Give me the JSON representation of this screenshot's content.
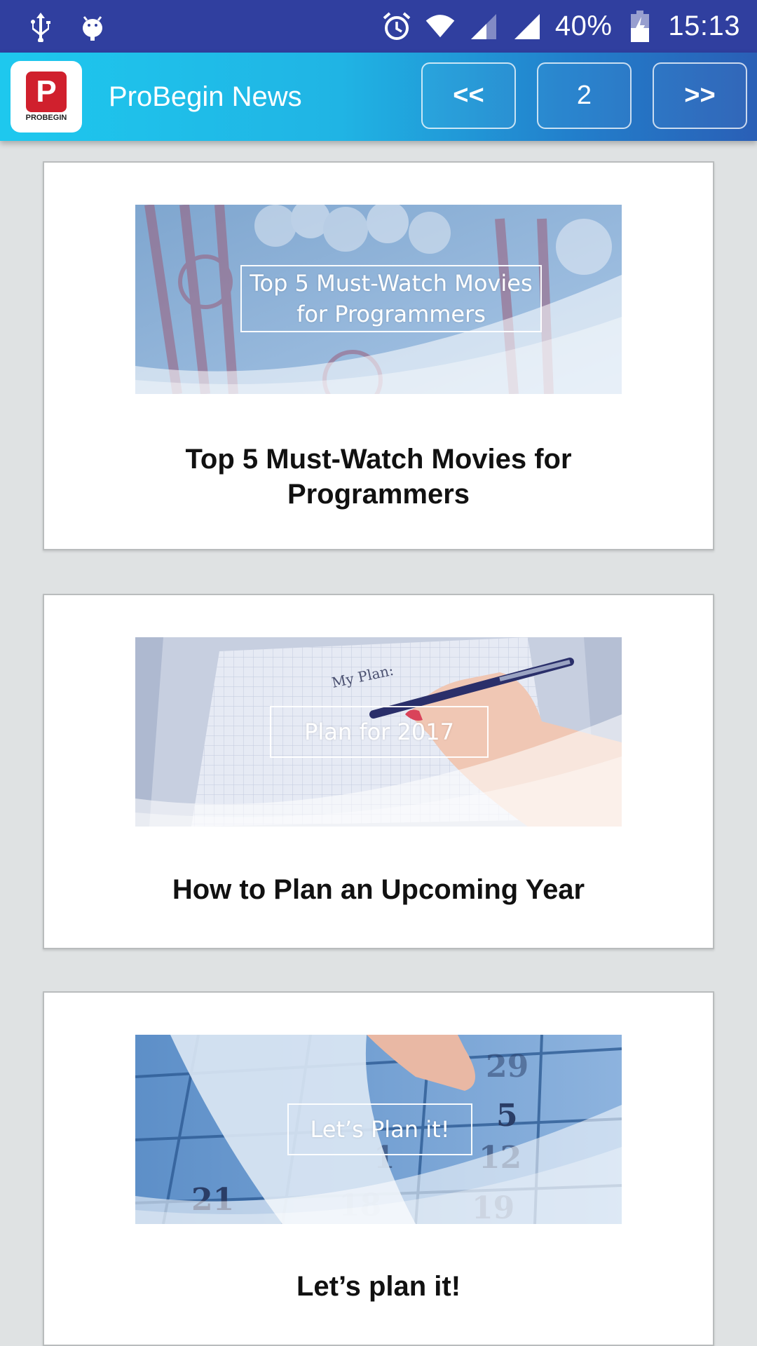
{
  "status_bar": {
    "icons": [
      "usb-icon",
      "android-debug-icon",
      "alarm-icon",
      "wifi-icon",
      "signal-icon",
      "signal-icon",
      "battery-charging-icon"
    ],
    "battery": "40%",
    "time": "15:13",
    "background": "#303f9f"
  },
  "app_bar": {
    "logo_letter": "P",
    "logo_text": "PROBEGIN",
    "title": "ProBegin News",
    "prev_label": "<<",
    "page": "2",
    "next_label": ">>"
  },
  "cards": [
    {
      "image_caption_line1": "Top 5 Must-Watch Movies",
      "image_caption_line2": "for Programmers",
      "title_line1": "Top 5 Must-Watch Movies for",
      "title_line2": "Programmers",
      "image_subject": "popcorn-image"
    },
    {
      "image_caption": "Plan for 2017",
      "image_note_text": "My Plan:",
      "title": "How to Plan an Upcoming Year",
      "image_subject": "notebook-pen-image"
    },
    {
      "image_caption": "Let’s Plan it!",
      "calendar_numbers": [
        "29",
        "5",
        "12",
        "1",
        "21",
        "18",
        "19"
      ],
      "title": "Let’s plan it!",
      "image_subject": "calendar-image"
    }
  ]
}
